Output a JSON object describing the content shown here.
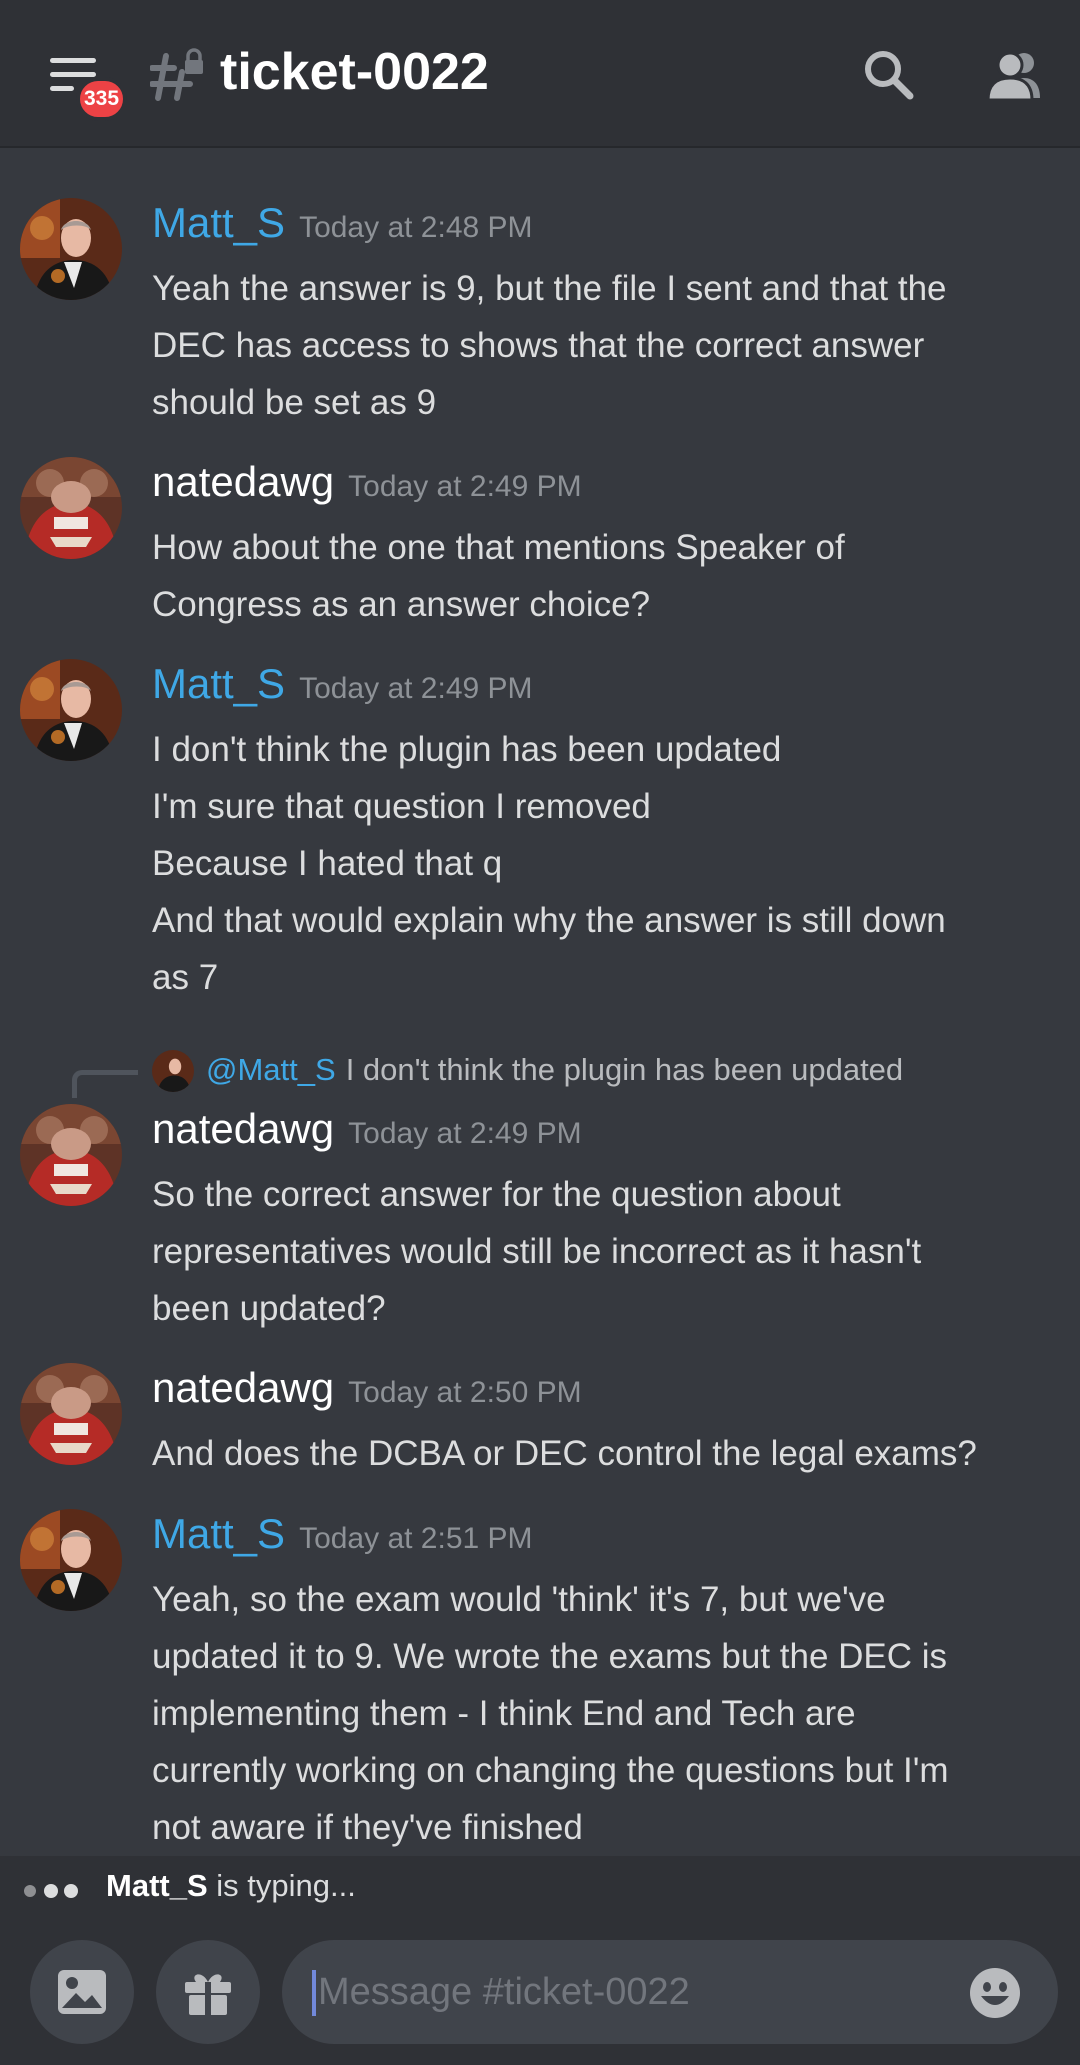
{
  "header": {
    "notification_count": "335",
    "channel_name": "ticket-0022"
  },
  "chat": {
    "cut_off_text": "incorrect",
    "messages": [
      {
        "author": "Matt_S",
        "timestamp": "Today at 2:48 PM",
        "lines": [
          "Yeah the answer is 9, but the file I sent and that the",
          "DEC has access to shows that the correct answer",
          "should be set as 9"
        ]
      },
      {
        "author": "natedawg",
        "timestamp": "Today at 2:49 PM",
        "lines": [
          "How about the one that mentions Speaker of",
          "Congress as an answer choice?"
        ]
      },
      {
        "author": "Matt_S",
        "timestamp": "Today at 2:49 PM",
        "lines": [
          "I don't think the plugin has been updated",
          "I'm sure that question I removed",
          "Because I hated that q",
          "And that would explain why the answer is still down",
          "as 7"
        ]
      },
      {
        "author": "natedawg",
        "timestamp": "Today at 2:49 PM",
        "reply_to": {
          "mention": "@Matt_S",
          "text": "I don't think the plugin has been updated"
        },
        "lines": [
          "So the correct answer for the question about",
          "representatives would still be incorrect as it hasn't",
          "been updated?"
        ]
      },
      {
        "author": "natedawg",
        "timestamp": "Today at 2:50 PM",
        "lines": [
          "And does the DCBA or DEC control the legal exams?"
        ]
      },
      {
        "author": "Matt_S",
        "timestamp": "Today at 2:51 PM",
        "lines": [
          "Yeah, so the exam would 'think' it's 7, but we've",
          "updated it to 9. We wrote the exams but the DEC is",
          "implementing them - I think End and Tech are",
          "currently working on changing the questions but I'm",
          "not aware if they've finished"
        ]
      }
    ]
  },
  "typing": {
    "user": "Matt_S",
    "text": "is typing..."
  },
  "composer": {
    "placeholder": "Message #ticket-0022",
    "value": ""
  },
  "colors": {
    "background": "#36393f",
    "header": "#2f3136",
    "matt_name": "#3fa8e6",
    "nate_name": "#ffffff",
    "badge": "#ed4245",
    "timestamp": "#8e9297"
  },
  "icons": {
    "menu": "hamburger-menu-icon",
    "channel": "locked-text-channel-icon",
    "search": "search-icon",
    "members": "members-icon",
    "image": "image-icon",
    "gift": "gift-icon",
    "emoji": "emoji-icon"
  }
}
